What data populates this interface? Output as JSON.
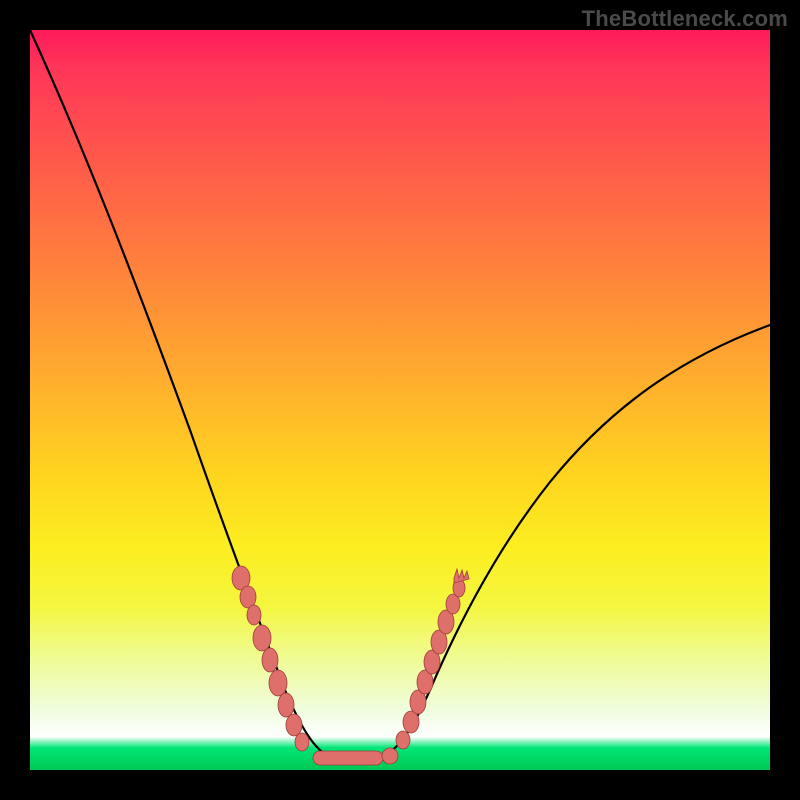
{
  "watermark": "TheBottleneck.com",
  "colors": {
    "frame": "#000000",
    "gradient_top": "#ff1a5a",
    "gradient_mid": "#ffd41f",
    "gradient_bottom_white": "#ffffff",
    "gradient_green": "#00c853",
    "curve": "#000000",
    "bead_fill": "#df6f6a",
    "bead_stroke": "#9c3f3a"
  },
  "chart_data": {
    "type": "line",
    "title": "",
    "xlabel": "",
    "ylabel": "",
    "xlim": [
      0,
      100
    ],
    "ylim": [
      0,
      100
    ],
    "note": "Values estimated from pixel positions; y is percent height from bottom (0 = bottom green, 100 = top red). No axis ticks or numeric labels are rendered in the image.",
    "series": [
      {
        "name": "bottleneck-curve",
        "x": [
          0,
          4,
          8,
          12,
          16,
          20,
          24,
          28,
          30,
          32,
          34,
          36,
          38,
          40,
          42,
          44,
          46,
          48,
          50,
          52,
          54,
          58,
          62,
          66,
          70,
          76,
          82,
          88,
          94,
          100
        ],
        "y": [
          100,
          93,
          84,
          75,
          66,
          56,
          46,
          36,
          30,
          25,
          20,
          15,
          10,
          6,
          4,
          2,
          2,
          2,
          3,
          5,
          9,
          16,
          23,
          29,
          34,
          41,
          47,
          52,
          56,
          60
        ]
      }
    ],
    "markers": {
      "note": "Salmon bead clusters overlaying the curve near the trough.",
      "left_cluster_x_range": [
        27,
        36
      ],
      "right_cluster_x_range": [
        49,
        55
      ],
      "bottom_bar_x_range": [
        38,
        48
      ],
      "approx_y_of_clusters": "2–30"
    }
  }
}
